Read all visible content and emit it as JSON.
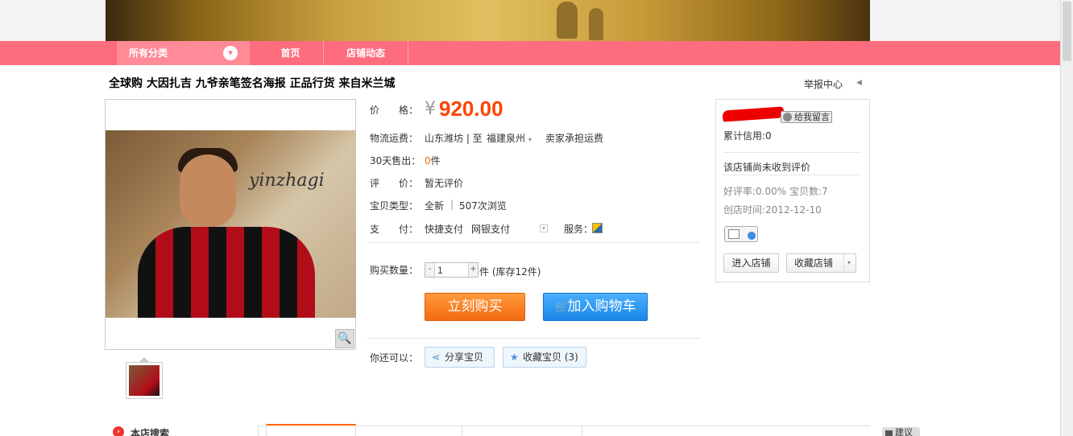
{
  "header": {
    "all_categories": "所有分类",
    "nav": [
      "首页",
      "店铺动态"
    ]
  },
  "item": {
    "title": "全球购 大因扎吉 九爷亲笔签名海报 正品行货 来自米兰城",
    "report": "举报中心",
    "price_label": "价　　格：",
    "price_symbol": "¥",
    "price": "920.00",
    "shipping_label": "物流运费：",
    "shipping_from": "山东潍坊 | 至",
    "shipping_to": "福建泉州",
    "shipping_note": "卖家承担运费",
    "sold_label": "30天售出：",
    "sold_count": "0",
    "sold_unit": "件",
    "rating_label": "评　　价：",
    "rating_value": "暂无评价",
    "type_label": "宝贝类型：",
    "type_value": "全新",
    "views": "507次浏览",
    "pay_label": "支　　付：",
    "pay_quick": "快捷支付",
    "pay_bank": "网银支付",
    "service_label": "服务：",
    "qty_label": "购买数量：",
    "qty_value": "1",
    "stock": "件 (库存12件)",
    "buy_now": "立刻购买",
    "add_cart": "加入购物车",
    "also_label": "你还可以：",
    "share": "分享宝贝",
    "favorite": "收藏宝贝 (3)",
    "photo_signature": "yinzhagi"
  },
  "shop": {
    "message_btn": "给我留言",
    "credit": "累计信用:0",
    "no_review": "该店铺尚未收到评价",
    "good_rate": "好评率:0.00% 宝贝数:7",
    "created": "创店时间:2012-12-10",
    "enter_shop": "进入店铺",
    "fav_shop": "收藏店铺"
  },
  "bottom": {
    "search": "本店搜索",
    "advice": "建议"
  },
  "colors": {
    "nav_bg": "#fe6d7d",
    "price": "#ff4400",
    "buy_now": "#f46a10",
    "add_cart": "#1a86e8"
  }
}
